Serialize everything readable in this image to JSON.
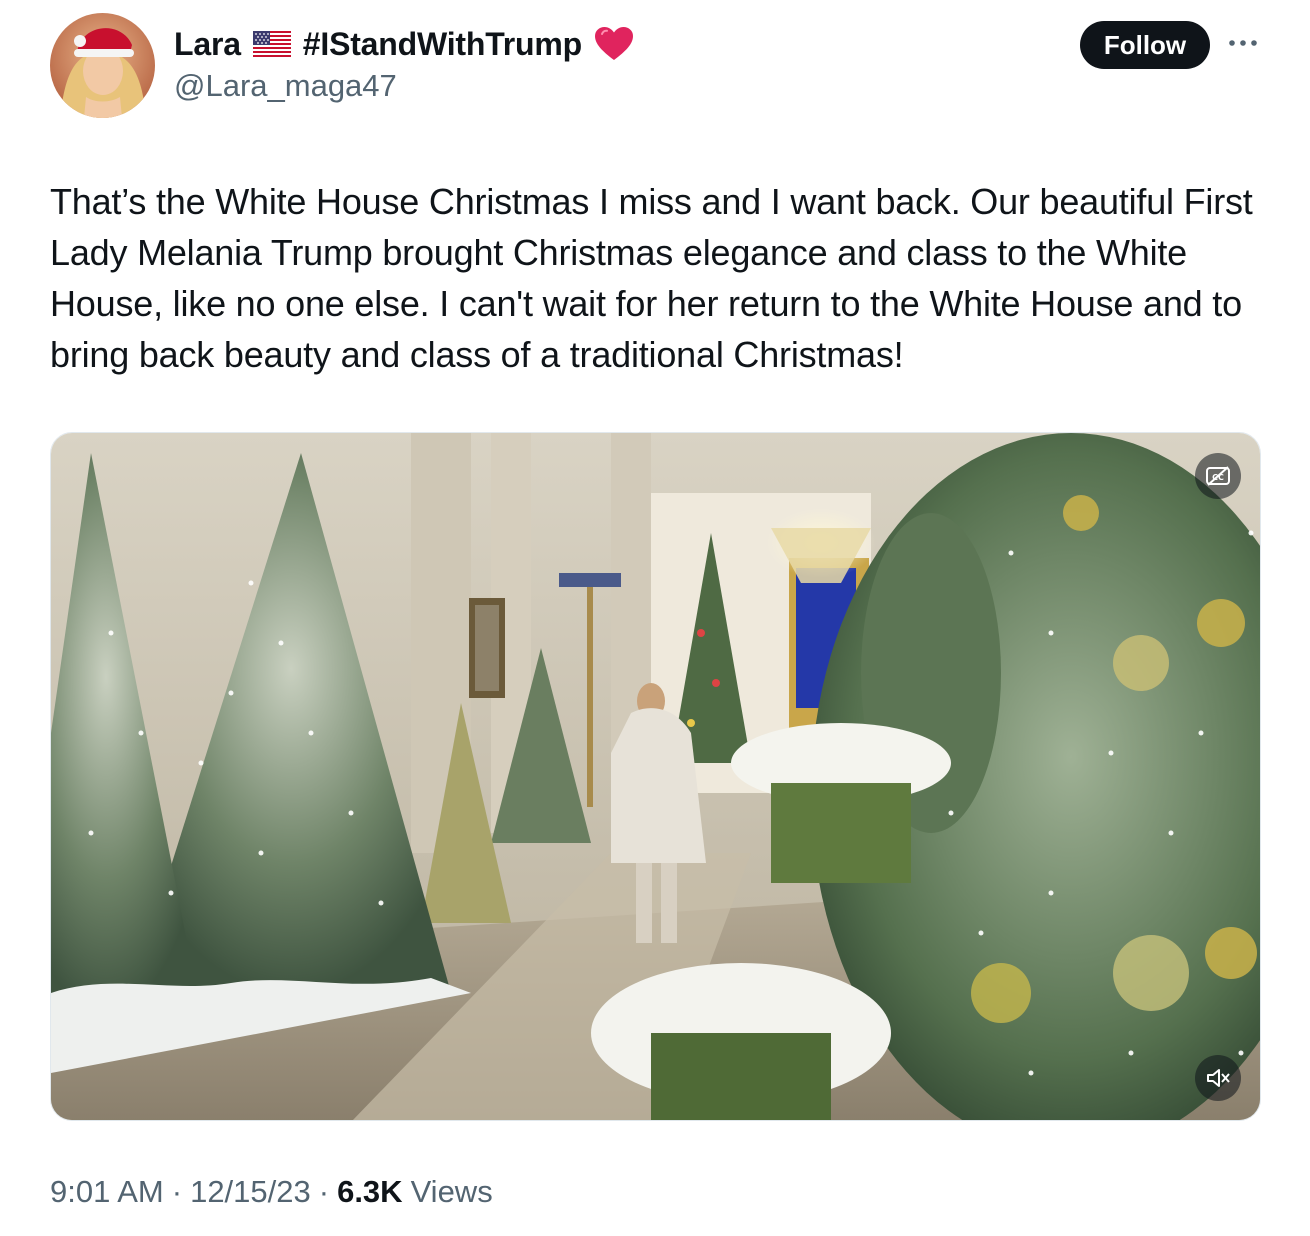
{
  "author": {
    "display_name": "Lara",
    "hashtag": "#IStandWithTrump",
    "handle": "@Lara_maga47",
    "flag_icon": "us-flag-icon",
    "heart_icon": "red-heart-icon"
  },
  "actions": {
    "follow_label": "Follow",
    "more_icon": "more-dots-icon"
  },
  "tweet": {
    "text": "That’s the White House Christmas I miss and I want back. Our beautiful First Lady Melania Trump brought Christmas elegance and class to the White House, like no one else. I can't wait for her return to the White House and to bring back beauty and class of a traditional Christmas!"
  },
  "media": {
    "type": "video",
    "captions_icon": "captions-off-icon",
    "volume_icon": "volume-muted-icon"
  },
  "footer": {
    "time": "9:01 AM",
    "date": "12/15/23",
    "separator": "·",
    "views_count": "6.3K",
    "views_label": "Views"
  },
  "colors": {
    "text_primary": "#0f1419",
    "text_secondary": "#536471",
    "follow_bg": "#0f1419",
    "heart": "#e0245e"
  }
}
